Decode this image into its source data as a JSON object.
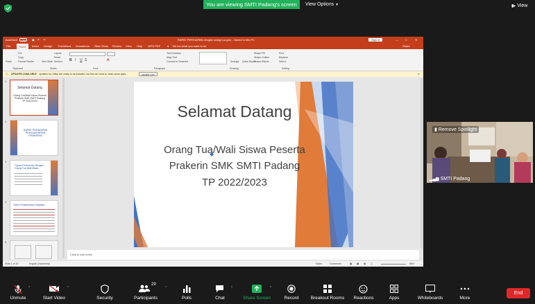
{
  "top_bar": {
    "banner": "You are viewing SMTI Padang's screen",
    "view_options": "View Options",
    "view": "View"
  },
  "ppt": {
    "autosave": "AutoSave",
    "autosave_state": "Off",
    "title": "RAPAT PERSIAPAN dengan orang tua.pptx - Saved to this PC",
    "sign_in": "Sign in",
    "tabs": [
      "File",
      "Home",
      "Insert",
      "Design",
      "Transitions",
      "Animations",
      "Slide Show",
      "Review",
      "View",
      "Help",
      "WPS PDF"
    ],
    "tell_me": "Tell me what you want to do",
    "share": "Share",
    "ribbon_groups": [
      "Clipboard",
      "Slides",
      "Font",
      "Paragraph",
      "Drawing",
      "Editing"
    ],
    "ribbon_items": {
      "paste": "Paste",
      "cut": "Cut",
      "copy": "Copy",
      "format_painter": "Format Painter",
      "new_slide": "New Slide",
      "layout": "Layout",
      "reset": "Reset",
      "section": "Section",
      "text_direction": "Text Direction",
      "align_text": "Align Text",
      "convert_smartart": "Convert to SmartArt",
      "arrange": "Arrange",
      "quick_styles": "Quick Styles",
      "shape_fill": "Shape Fill",
      "shape_outline": "Shape Outline",
      "shape_effects": "Shape Effects",
      "find": "Find",
      "replace": "Replace",
      "select": "Select"
    },
    "update_bar": {
      "title": "UPDATES AVAILABLE",
      "message": "Updates for Office are ready to be installed, but first we need to close some apps.",
      "button": "Update now"
    },
    "slide": {
      "title": "Selamat Datang",
      "line1": "Orang Tua/Wali Siswa Peserta",
      "line2": "Prakerin SMK SMTI Padang",
      "line3": "TP 2022/2023"
    },
    "thumbnails": [
      {
        "num": "1",
        "title": "Selamat Datang",
        "text": "Orang Tua/Wali Siswa Peserta Prakerin SMK SMTI Padang TP 2022/2023"
      },
      {
        "num": "2",
        "title": "RAPAT PERSIAPAN PENGANTARAN PRAKERIN",
        "text": ""
      },
      {
        "num": "3",
        "title": "Tujuan Pertemuan Dengan Orang Tua Wali Siswa",
        "text": ""
      },
      {
        "num": "4",
        "title": "Tahun Pelaksanaan Kegiatan",
        "text": ""
      },
      {
        "num": "5",
        "title": "",
        "text": ""
      }
    ],
    "notes": "Click to add notes",
    "status": {
      "slide_of": "Slide 1 of 20",
      "language": "English (Indonesia)",
      "notes": "Notes",
      "comments": "Comments",
      "zoom": "55%"
    }
  },
  "video": {
    "participant": "SMTI Padang",
    "spotlight": "Remove Spotlight"
  },
  "toolbar": {
    "unmute": "Unmute",
    "start_video": "Start Video",
    "security": "Security",
    "participants": "Participants",
    "participants_count": "29",
    "polls": "Polls",
    "chat": "Chat",
    "share_screen": "Share Screen",
    "record": "Record",
    "breakout_rooms": "Breakout Rooms",
    "reactions": "Reactions",
    "apps": "Apps",
    "whiteboards": "Whiteboards",
    "more": "More",
    "end": "End"
  },
  "colors": {
    "zoom_green": "#21b25b",
    "ppt_red": "#c43e1c",
    "end_red": "#e02828",
    "slide_orange": "#e07b39",
    "slide_blue": "#4472c4"
  }
}
